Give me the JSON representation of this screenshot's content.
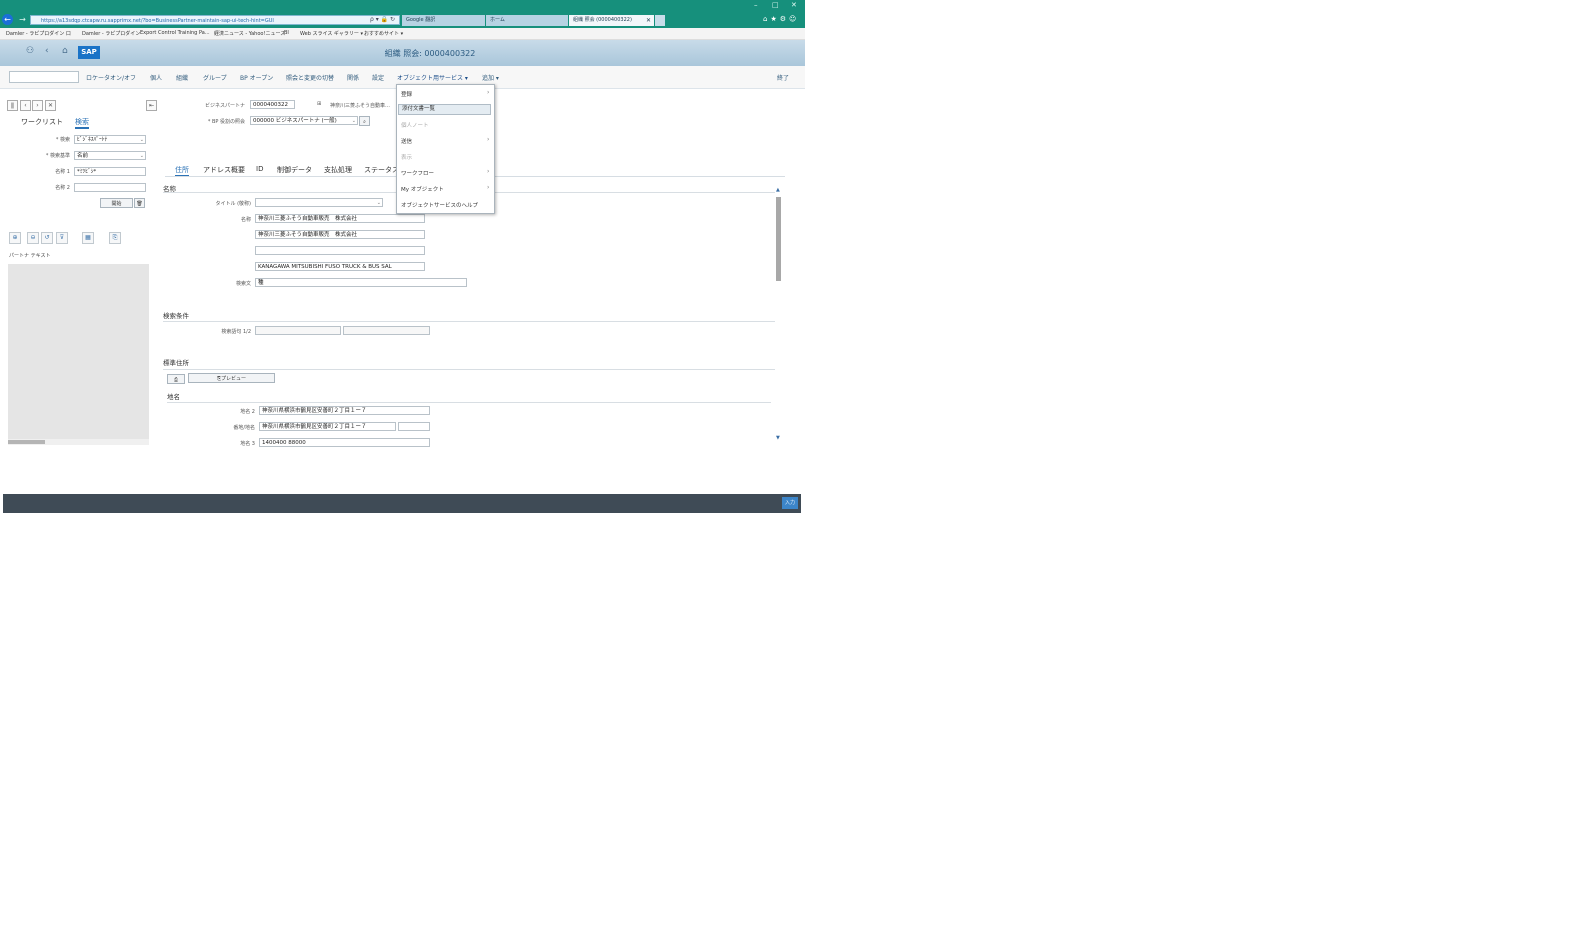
{
  "browser": {
    "window_controls": [
      "–",
      "□",
      "✕"
    ],
    "address": "https://a13sdqp.ctcapw.ru.sapprimx.net/?bo=BusinessPartner-maintain-sap-ui-tech-hint=GUI",
    "address_tools": "ρ ▾ 🔒 ↻",
    "tabs": [
      {
        "label": "Google 翻訳"
      },
      {
        "label": "ホーム"
      },
      {
        "label": "組織 照会 (0000400322)"
      }
    ],
    "tab_close": "✕",
    "toolbar_icons": "⌂★⚙☺",
    "favorites": [
      "Damler - ラピプロダイン 口",
      "Damler - ラピプロダイン",
      "Export Control Training Pa...",
      "経済ニュース - Yahoo!ニュース",
      "BI",
      "Web スライス ギャラリー ▾",
      "おすすめサイト ▾"
    ]
  },
  "shell": {
    "logo": "SAP",
    "title": "組織 照会: 0000400322"
  },
  "menu": {
    "items": [
      "ロケータオン/オフ",
      "個人",
      "組織",
      "グループ",
      "BP オープン",
      "照会と変更の切替",
      "関係",
      "設定",
      "オブジェクト用サービス ▾",
      "追加 ▾"
    ],
    "exit": "終了"
  },
  "dropdown": {
    "items": [
      {
        "label": "登録",
        "arrow": true,
        "disabled": false
      },
      {
        "label": "添付文書一覧",
        "arrow": false,
        "disabled": false,
        "selected": true
      },
      {
        "label": "個人ノート",
        "arrow": false,
        "disabled": true
      },
      {
        "label": "送信",
        "arrow": true,
        "disabled": false
      },
      {
        "label": "表示",
        "arrow": false,
        "disabled": true
      },
      {
        "label": "ワークフロー",
        "arrow": true,
        "disabled": false
      },
      {
        "label": "My オブジェクト",
        "arrow": true,
        "disabled": false
      },
      {
        "label": "オブジェクトサービスのヘルプ",
        "arrow": false,
        "disabled": false
      }
    ],
    "arrow_glyph": "›"
  },
  "left": {
    "nav": [
      "ǁ",
      "‹",
      "›",
      "✕"
    ],
    "collapse": "⇤",
    "tabs": [
      "ワークリスト",
      "検索"
    ],
    "search": {
      "find_label": "* 検索",
      "find_value": "ﾋﾞｼﾞﾈｽﾊﾟｰﾄﾅ",
      "by_label": "* 検索基準",
      "by_value": "名前",
      "name1_label": "名称 1",
      "name1_value": "*ﾐﾂﾋﾞｼ*",
      "name2_label": "名称 2",
      "name2_value": "",
      "start": "開始",
      "trash": "🗑"
    },
    "toolbar": [
      "⊕",
      "⊖",
      "↺",
      "⊽",
      "▦",
      "⎘"
    ],
    "results_header": "パートナ    テキスト"
  },
  "main": {
    "bp_label": "ビジネスパートナ",
    "bp_value": "0000400322",
    "bp_desc": "神奈川三菱ふそう自動車…",
    "role_label": "* BP 役割の照会",
    "role_value": "000000 ビジネスパートナ (一般)",
    "tabs": [
      "住所",
      "アドレス概要",
      "ID",
      "制御データ",
      "支払処理",
      "ステータス"
    ],
    "sections": {
      "name": "名称",
      "search_terms": "検索条件",
      "std_address": "標準住所",
      "street": "地名"
    },
    "title_label": "タイトル (敬称)",
    "title_value": "",
    "name_label": "名称",
    "name_lines": [
      "神奈川三菱ふそう自動車販売　株式会社",
      "神奈川三菱ふそう自動車販売　株式会社",
      "",
      "KANAGAWA MITSUBISHI FUSO TRUCK & BUS SAL"
    ],
    "short_label": "検索文",
    "short_value": "種",
    "search_label": "検索語句 1/2",
    "preview_btn": "プレビュー",
    "street_label": "地名 2",
    "street_value": "神奈川県横浜市鶴見区安善町２丁目１ー７",
    "city_label": "番地/地名",
    "city_value": "神奈川県横浜市鶴見区安善町２丁目１ー７",
    "phone_label": "地名 3",
    "phone_value": "1400400 88000"
  },
  "status_button": "入力",
  "colors": {
    "chrome": "#16907c",
    "sap_accent": "#2b72b6",
    "status_bar": "#3f4b56"
  }
}
